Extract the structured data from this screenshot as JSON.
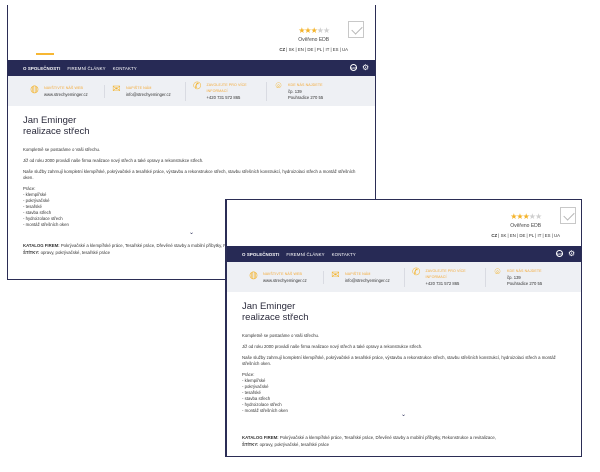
{
  "rating": {
    "stars": [
      "★",
      "★",
      "★",
      "★",
      "★"
    ],
    "filled": 3,
    "verified_label": "Ověřeno EDB",
    "languages": [
      "CZ",
      "SK",
      "EN",
      "DE",
      "PL",
      "IT",
      "ES",
      "UA"
    ],
    "active_language": "CZ"
  },
  "nav": {
    "items": [
      "O SPOLEČNOSTI",
      "FIREMNÍ ČLÁNKY",
      "KONTAKTY"
    ],
    "active": "O SPOLEČNOSTI",
    "icon_edb": "EDB",
    "icon_settings": "⚙"
  },
  "contacts": [
    {
      "icon": "globe-icon",
      "glyph": "◍",
      "label": "NAVŠTIVTE NÁŠ WEB",
      "value": "www.strechyeminger.cz"
    },
    {
      "icon": "mail-icon",
      "glyph": "✉",
      "label": "NAPIŠTE NÁM",
      "value": "info@strechyeminger.cz"
    },
    {
      "icon": "phone-icon",
      "glyph": "✆",
      "label": "ZAVOLEJTE PRO VÍCE INFORMACÍ",
      "value": "+420 731 572 865"
    },
    {
      "icon": "location-pin-icon",
      "glyph": "⌾",
      "label": "KDE NÁS NAJDETE",
      "value": "čp. 139\nPouhradice 270 55"
    }
  ],
  "company": {
    "name_line1": "Jan Eminger",
    "name_line2": "realizace střech"
  },
  "about": {
    "p1": "Kompletně se postaráme o Vaši střechu.",
    "p2": "Již od roku 2000 provádí naše firma realizace nový střech a také opravy a rekonstrukce střech.",
    "p3": "Naše služby zahrnují kompletní klempířské, pokrývačské a tesařské práce, výstavbu a rekonstrukce střech, stavbu střešních konstrukcí, hydroizolaci střech a montáž střešních oken.",
    "list_head": "Práce:",
    "list": [
      "- klempířské",
      "- pokrývačské",
      "- tesařské",
      "- stavba střech",
      "- hydroizolace střech",
      "- montáž střešních oken"
    ],
    "expand_glyph": "⌄"
  },
  "footer": {
    "catalog_label": "KATALOG FIREM:",
    "catalog_value": "Pokrývačské a klempířské práce, Tesařské práce, Dřevěné stavby a mobilní příbytky, Rekonstrukce a revitalizace,",
    "labels_label": "ŠTÍTKY:",
    "labels_value": "opravy, pokrývačské, tesařské práce"
  }
}
